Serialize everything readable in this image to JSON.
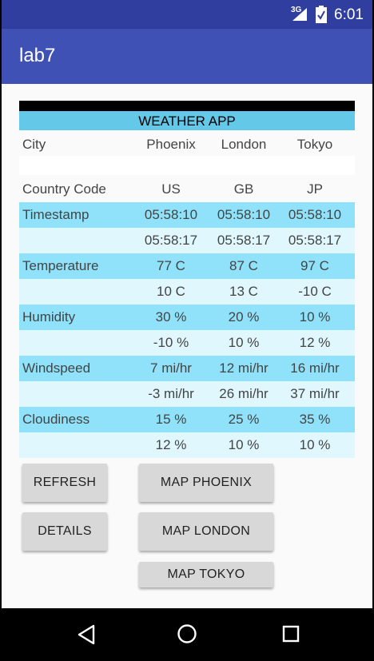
{
  "status_bar": {
    "network": "3G",
    "time": "6:01"
  },
  "app_bar": {
    "title": "lab7"
  },
  "table": {
    "title": "WEATHER APP",
    "city_row": {
      "label": "City",
      "values": [
        "Phoenix",
        "London",
        "Tokyo"
      ]
    },
    "country_row": {
      "label": "Country Code",
      "values": [
        "US",
        "GB",
        "JP"
      ]
    },
    "rows": [
      {
        "label": "Timestamp",
        "shade": "dark",
        "values": [
          "05:58:10",
          "05:58:10",
          "05:58:10"
        ]
      },
      {
        "label": "",
        "shade": "light",
        "values": [
          "05:58:17",
          "05:58:17",
          "05:58:17"
        ]
      },
      {
        "label": "Temperature",
        "shade": "dark",
        "values": [
          "77 C",
          "87 C",
          "97 C"
        ]
      },
      {
        "label": "",
        "shade": "light",
        "values": [
          "10 C",
          "13 C",
          "-10 C"
        ]
      },
      {
        "label": "Humidity",
        "shade": "dark",
        "values": [
          "30 %",
          "20 %",
          "10 %"
        ]
      },
      {
        "label": "",
        "shade": "light",
        "values": [
          "-10 %",
          "10 %",
          "12 %"
        ]
      },
      {
        "label": "Windspeed",
        "shade": "dark",
        "values": [
          "7 mi/hr",
          "12 mi/hr",
          "16 mi/hr"
        ]
      },
      {
        "label": "",
        "shade": "light",
        "values": [
          "-3 mi/hr",
          "26 mi/hr",
          "37 mi/hr"
        ]
      },
      {
        "label": "Cloudiness",
        "shade": "dark",
        "values": [
          "15 %",
          "25 %",
          "35 %"
        ]
      },
      {
        "label": "",
        "shade": "light",
        "values": [
          "12 %",
          "10 %",
          "10 %"
        ]
      }
    ]
  },
  "buttons": {
    "refresh": "REFRESH",
    "details": "DETAILS",
    "map_phoenix": "MAP PHOENIX",
    "map_london": "MAP LONDON",
    "map_tokyo": "MAP TOKYO"
  },
  "colors": {
    "status_bar": "#303f9f",
    "app_bar": "#3f51b5",
    "header_bar": "#64c8e8",
    "row_dark": "#8fe2fa",
    "row_light": "#dff7fd"
  },
  "icons": {
    "status": [
      "signal-icon",
      "battery-icon"
    ],
    "nav": [
      "back-icon",
      "home-icon",
      "recent-apps-icon"
    ]
  }
}
